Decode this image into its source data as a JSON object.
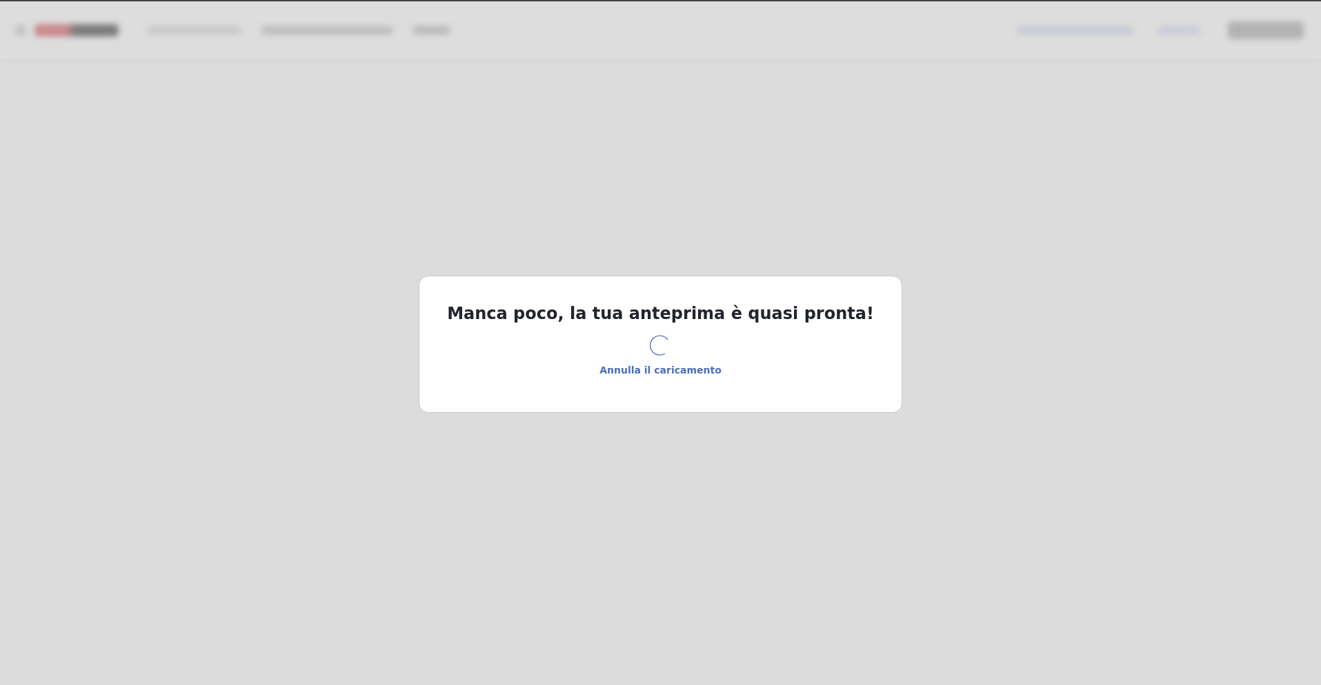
{
  "dialog": {
    "title": "Manca poco, la tua anteprima è quasi pronta!",
    "cancel_link": "Annulla il caricamento"
  }
}
